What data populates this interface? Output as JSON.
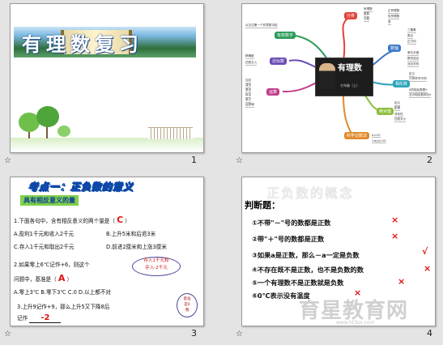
{
  "slides": [
    {
      "number": "1",
      "banner_title": "有理数复习"
    },
    {
      "number": "2",
      "center_title": "有理数",
      "center_subtitle": "七年级（上）",
      "branches": [
        {
          "label": "分类",
          "color": "#e0433a",
          "leaves": [
            "有理数",
            "整数",
            "分数",
            "正有理数",
            "负有理数",
            "零"
          ]
        },
        {
          "label": "数轴",
          "color": "#3c78c8",
          "leaves": [
            "三要素",
            "原点",
            "正方向",
            "单位长度",
            "数形结合",
            "对应关系"
          ]
        },
        {
          "label": "相反数",
          "color": "#2aa3b8",
          "leaves": [
            "定义",
            "只有符号不同",
            "0的相反数是0",
            "互为相反数和为0"
          ]
        },
        {
          "label": "绝对值",
          "color": "#8bbd3a",
          "leaves": [
            "定义",
            "距离",
            "非负性",
            "比较大小"
          ]
        },
        {
          "label": "运算",
          "color": "#c23c8c",
          "leaves": [
            "加法",
            "减法",
            "乘法",
            "除法",
            "乘方",
            "运算律"
          ]
        },
        {
          "label": "科学记数法",
          "color": "#e08a2a",
          "leaves": [
            "a×10ⁿ",
            "1≤|a|<10"
          ]
        },
        {
          "label": "近似数",
          "color": "#6a4bb5",
          "leaves": [
            "精确度",
            "四舍五入"
          ]
        },
        {
          "label": "有效数字",
          "color": "#2b9b57",
          "leaves": [
            "从左边第一个非零数字起"
          ]
        }
      ]
    },
    {
      "number": "3",
      "title": "考点一：正负数的意义",
      "subheading": "具有相反意义的量",
      "q1": "1.下面各句中，含有相反意义的两个量是（",
      "q1_answer": "C",
      "q1_end": "）",
      "q1_a": "A.盈利1千元和收入2千元",
      "q1_b": "B.上升5米和后退3米",
      "q1_c": "C.存入1千元和取出2千元",
      "q1_d": "D.前进2厘米和上涨3厘米",
      "q2_line1": "2.如果零上6℃记作+6，则这个",
      "q2_line2": "问题中，基准是（",
      "q2_answer": "A",
      "q2_end": "）",
      "q2_opts": "A.零上3℃   B.零下3℃   C.0   D.以上都不对",
      "q3_line1": "3.上升9记作+9，那么上升5又下降8后",
      "q3_line2": "记作",
      "q3_answer": "-2",
      "bubble": "存入1千元和\n存入-2千元",
      "circle": "基准\n是0\n哦"
    },
    {
      "number": "4",
      "title": "正负数的概念",
      "heading": "判断题：",
      "items": [
        {
          "text": "①不带\"－\"号的数都是正数",
          "mark": "×"
        },
        {
          "text": "②带\"＋\"号的数都是正数",
          "mark": "×"
        },
        {
          "text": "③如果a是正数，那么－a一定是负数",
          "mark": "√"
        },
        {
          "text": "④不存在既不是正数，也不是负数的数",
          "mark": "×"
        },
        {
          "text": "⑤一个有理数不是正数就是负数",
          "mark": "×"
        },
        {
          "text": "⑥0℃表示没有温度",
          "mark": "×"
        }
      ],
      "watermark": "育星教育网",
      "watermark_url": "www.ht3sx.com"
    }
  ],
  "slide_marker": "☆"
}
